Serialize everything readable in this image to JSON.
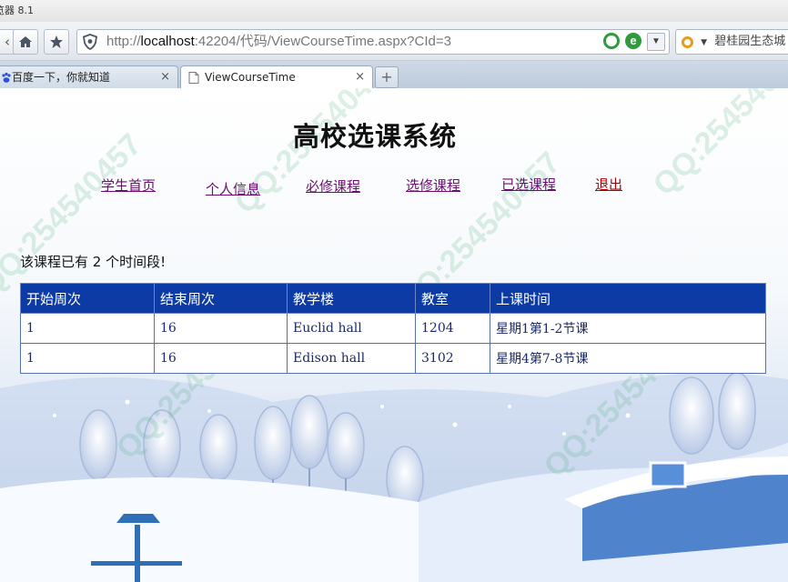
{
  "browser": {
    "title": "览器 8.1",
    "url_prefix": "http://",
    "url_host": "localhost",
    "url_rest": ":42204/代码/ViewCourseTime.aspx?CId=3",
    "search_text": "碧桂园生态城",
    "tabs": [
      {
        "label": "百度一下，你就知道",
        "close": "×"
      },
      {
        "label": "ViewCourseTime",
        "close": "×"
      }
    ],
    "new_tab": "+",
    "icons": {
      "home": "home-icon",
      "favorite": "star-icon",
      "security": "shield-icon"
    }
  },
  "site": {
    "title": "高校选课系统",
    "menu": [
      {
        "label": "学生首页"
      },
      {
        "label": "个人信息"
      },
      {
        "label": "必修课程"
      },
      {
        "label": "选修课程"
      },
      {
        "label": "已选课程"
      },
      {
        "label": "退出"
      }
    ]
  },
  "course": {
    "count_text": "该课程已有  2 个时间段!"
  },
  "table": {
    "headers": [
      "开始周次",
      "结束周次",
      "教学楼",
      "教室",
      "上课时间"
    ],
    "rows": [
      [
        "1",
        "16",
        "Euclid hall",
        "1204",
        "星期1第1-2节课"
      ],
      [
        "1",
        "16",
        "Edison hall",
        "3102",
        "星期4第7-8节课"
      ]
    ]
  },
  "watermarks": [
    "QQ:254540457",
    "QQ:254540457",
    "QQ:254540457",
    "QQ:254540457",
    "QQ:254540457",
    "QQ:254540457"
  ],
  "colors": {
    "table_header": "#0d3ba5",
    "menu_link": "#6a0d6f",
    "logout_link": "#b10000"
  }
}
